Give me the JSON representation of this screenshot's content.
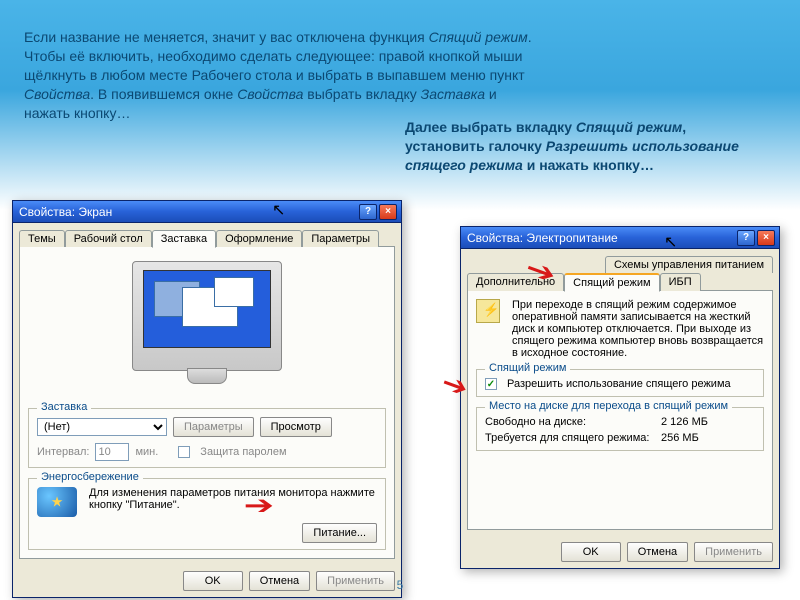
{
  "intro": {
    "p1a": "Если название не меняется, значит у вас отключена функция ",
    "p1b": "Спящий режим",
    "p1c": ". Чтобы её включить, необходимо сделать следующее: правой кнопкой мыши щёлкнуть в любом месте Рабочего стола и выбрать в выпавшем меню пункт ",
    "p1d": "Свойства",
    "p1e": ". В появившемся окне ",
    "p1f": "Свойства",
    "p1g": " выбрать вкладку ",
    "p1h": "Заставка",
    "p1i": " и нажать кнопку…"
  },
  "intro2": {
    "a": "Далее выбрать вкладку ",
    "b": "Спящий режим",
    "c": ", установить галочку ",
    "d": "Разрешить использование спящего режима",
    "e": " и нажать кнопку…"
  },
  "win1": {
    "title": "Свойства: Экран",
    "help": "?",
    "close": "×",
    "tabs": [
      "Темы",
      "Рабочий стол",
      "Заставка",
      "Оформление",
      "Параметры"
    ],
    "group_zastavka": {
      "legend": "Заставка",
      "value": "(Нет)",
      "btn_params": "Параметры",
      "btn_preview": "Просмотр",
      "interval_label": "Интервал:",
      "interval_value": "10",
      "interval_unit": "мин.",
      "protect": "Защита паролем"
    },
    "group_energy": {
      "legend": "Энергосбережение",
      "text": "Для изменения параметров питания монитора нажмите кнопку \"Питание\".",
      "btn": "Питание..."
    },
    "ok": "OK",
    "cancel": "Отмена",
    "apply": "Применить"
  },
  "win2": {
    "title": "Свойства: Электропитание",
    "help": "?",
    "close": "×",
    "tabs_row1": [
      "Схемы управления питанием"
    ],
    "tabs_row2": [
      "Дополнительно",
      "Спящий режим",
      "ИБП"
    ],
    "desc": "При переходе в спящий режим содержимое оперативной памяти записывается на жесткий диск и компьютер отключается. При выходе из спящего режима компьютер вновь возвращается в исходное состояние.",
    "group_sleep": {
      "legend": "Спящий режим",
      "check_label": "Разрешить использование спящего режима"
    },
    "group_disk": {
      "legend": "Место на диске для перехода в спящий режим",
      "free_label": "Свободно на диске:",
      "free_value": "2 126 МБ",
      "need_label": "Требуется для спящего режима:",
      "need_value": "256 МБ"
    },
    "ok": "OK",
    "cancel": "Отмена",
    "apply": "Применить"
  },
  "page_number": "5"
}
